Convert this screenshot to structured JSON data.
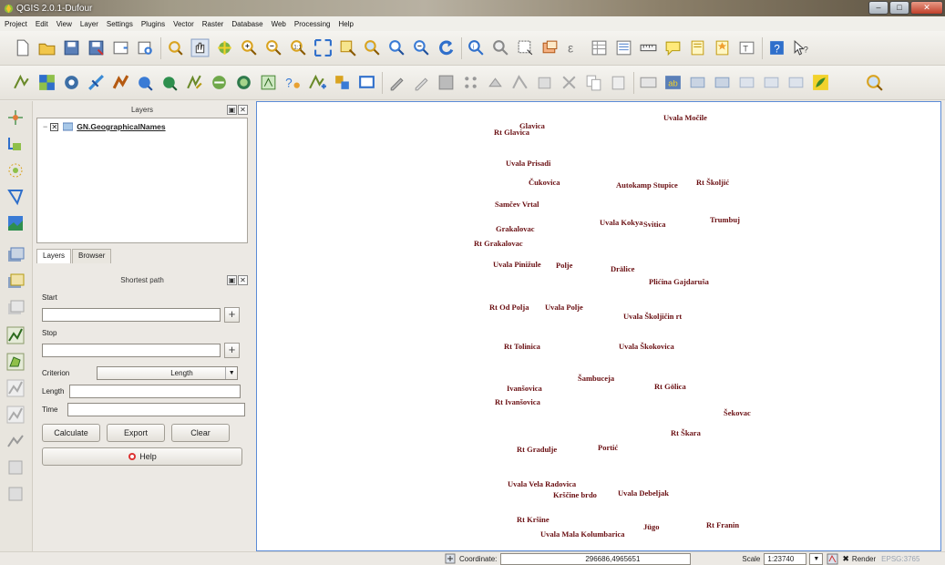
{
  "window": {
    "title": "QGIS 2.0.1-Dufour"
  },
  "menu": [
    "Project",
    "Edit",
    "View",
    "Layer",
    "Settings",
    "Plugins",
    "Vector",
    "Raster",
    "Database",
    "Web",
    "Processing",
    "Help"
  ],
  "layers_panel": {
    "title": "Layers",
    "layer_name": "GN.GeographicalNames",
    "layer_checked": "✕",
    "tabs": [
      "Layers",
      "Browser"
    ]
  },
  "shortest_path": {
    "title": "Shortest path",
    "start_label": "Start",
    "stop_label": "Stop",
    "criterion_label": "Criterion",
    "criterion_value": "Length",
    "length_label": "Length",
    "time_label": "Time",
    "calculate": "Calculate",
    "export": "Export",
    "clear": "Clear",
    "help": "Help",
    "plus": "+"
  },
  "map": {
    "labels": [
      "Uvala Močile",
      "Rt Glavica",
      "Glavica",
      "Uvala Prisadi",
      "Čukovica",
      "Autokamp Stupice",
      "Rt Školjić",
      "Samčev Vrtal",
      "Uvala Kokya",
      "Svitica",
      "Trumbuj",
      "Grakalovac",
      "Rt Grakalovac",
      "Uvala Pinižule",
      "Polje",
      "Drälice",
      "Plićina Gajdaruša",
      "Rt Od Polja",
      "Uvala Polje",
      "Uvala Školjičin rt",
      "Rt Tolinica",
      "Uvala Škokovica",
      "Šambuceja",
      "Ivanšovica",
      "Rt Ivanšovica",
      "Rt Gölica",
      "Šekovac",
      "Rt Škara",
      "Rt Gradulje",
      "Portić",
      "Uvala Vela Radovica",
      "Krščine brdo",
      "Uvala Debeljak",
      "Rt Kršine",
      "Jügo",
      "Rt Franin",
      "Uvala Mala Kolumbarica"
    ]
  },
  "status": {
    "coordinate_label": "Coordinate:",
    "coordinate_value": "296686,4965651",
    "scale_label": "Scale",
    "scale_value": "1:23740",
    "render_label": "Render",
    "crs": "EPSG:3765"
  },
  "colors": {
    "map_label": "#6a0f12",
    "map_border": "#5b8bd6"
  }
}
